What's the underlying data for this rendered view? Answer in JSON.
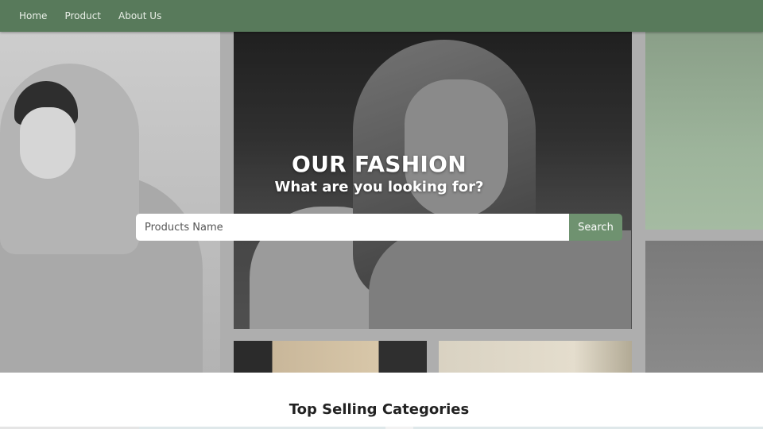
{
  "nav": {
    "items": [
      {
        "label": "Home"
      },
      {
        "label": "Product"
      },
      {
        "label": "About Us"
      }
    ],
    "background_color": "#587a5b"
  },
  "hero": {
    "title": "OUR FASHION",
    "subtitle": "What are you looking for?"
  },
  "search": {
    "placeholder": "Products Name",
    "value": "",
    "button_label": "Search",
    "button_color": "#6f9270"
  },
  "section": {
    "title": "Top Selling Categories"
  }
}
